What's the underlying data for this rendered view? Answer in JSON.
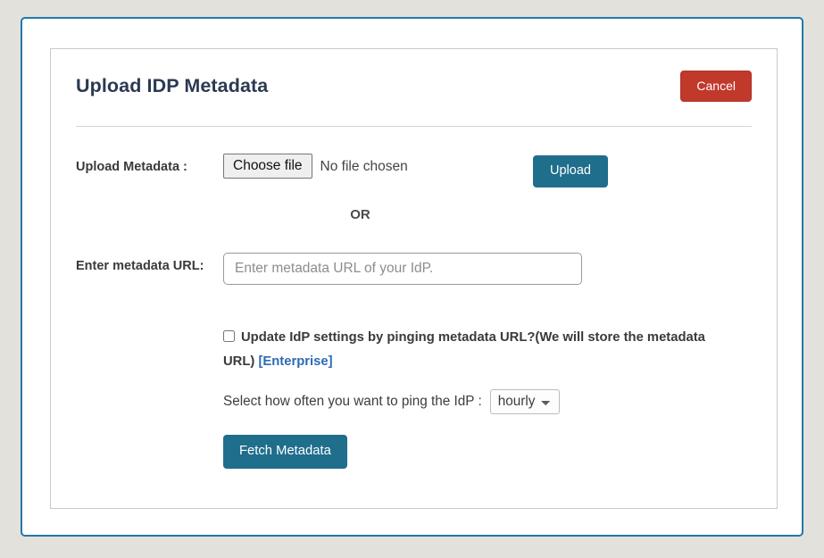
{
  "panel": {
    "title": "Upload IDP Metadata",
    "cancel_label": "Cancel"
  },
  "upload_row": {
    "label": "Upload Metadata :",
    "choose_file_label": "Choose file",
    "file_name": "No file chosen",
    "upload_label": "Upload"
  },
  "separator": {
    "or_label": "OR"
  },
  "url_row": {
    "label": "Enter metadata URL:",
    "placeholder": "Enter metadata URL of your IdP.",
    "value": ""
  },
  "ping": {
    "checkbox_checked": false,
    "checkbox_text": "Update IdP settings by pinging metadata URL?(We will store the metadata URL)",
    "enterprise_label": "[Enterprise]",
    "frequency_label": "Select how often you want to ping the IdP :",
    "frequency_selected": "hourly",
    "frequency_options": [
      "hourly"
    ],
    "fetch_label": "Fetch Metadata"
  },
  "colors": {
    "page_background": "#e3e1db",
    "shell_border": "#2178a8",
    "title": "#2b3a52",
    "cancel": "#c0392b",
    "primary": "#1f6e8c",
    "link": "#2c6bb5"
  }
}
